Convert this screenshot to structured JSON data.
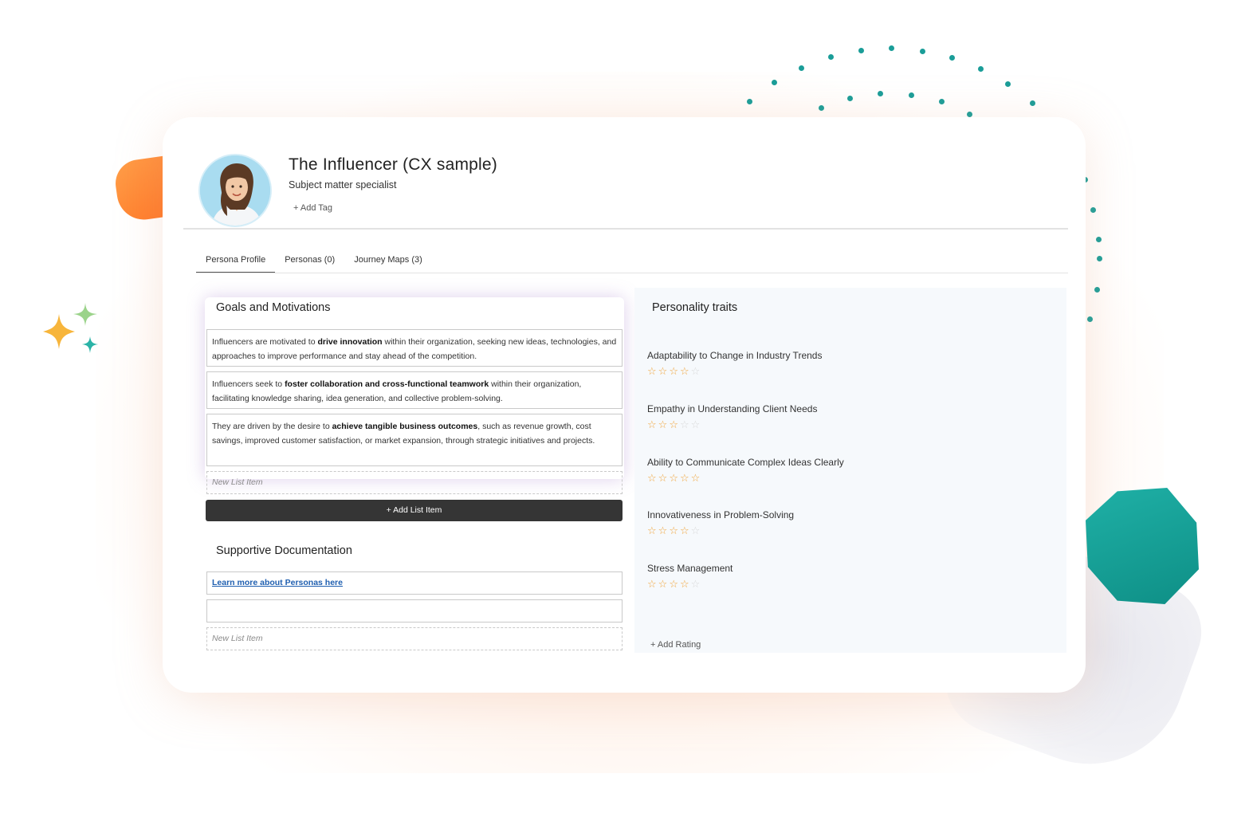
{
  "colors": {
    "accent_teal": "#1a9d98",
    "accent_orange": "#ff7a24",
    "star": "#f0a43a",
    "button_dark": "#353535",
    "link": "#1f5fb0"
  },
  "persona": {
    "name": "The Influencer (CX sample)",
    "subtitle": "Subject matter specialist",
    "add_tag": "+ Add Tag"
  },
  "tabs": [
    {
      "label": "Persona Profile",
      "active": true
    },
    {
      "label": "Personas (0)",
      "active": false
    },
    {
      "label": "Journey Maps (3)",
      "active": false
    }
  ],
  "goals": {
    "title": "Goals and Motivations",
    "items": [
      {
        "pre": "Influencers are motivated to ",
        "bold": "drive innovation",
        "post": " within their organization, seeking new ideas, technologies, and approaches to improve performance and stay ahead of the competition."
      },
      {
        "pre": "Influencers seek to ",
        "bold": "foster collaboration and cross-functional teamwork",
        "post": " within their organization, facilitating knowledge sharing, idea generation, and collective problem-solving."
      },
      {
        "pre": "They are driven by the desire to ",
        "bold": "achieve tangible business outcomes",
        "post": ", such as revenue growth, cost savings, improved customer satisfaction, or market expansion, through strategic initiatives and projects."
      }
    ],
    "new_item_placeholder": "New List Item",
    "add_button": "+ Add List Item"
  },
  "documentation": {
    "title": "Supportive Documentation",
    "link_text": "Learn more about Personas here",
    "new_item_placeholder": "New List Item"
  },
  "traits": {
    "title": "Personality traits",
    "items": [
      {
        "label": "Adaptability to Change in Industry Trends",
        "rating": 4,
        "max": 5
      },
      {
        "label": "Empathy in Understanding Client Needs",
        "rating": 3,
        "max": 5
      },
      {
        "label": "Ability to Communicate Complex Ideas Clearly",
        "rating": 5,
        "max": 5
      },
      {
        "label": "Innovativeness in Problem-Solving",
        "rating": 4,
        "max": 5
      },
      {
        "label": "Stress Management",
        "rating": 4,
        "max": 5
      }
    ],
    "add_rating": "+ Add Rating"
  }
}
